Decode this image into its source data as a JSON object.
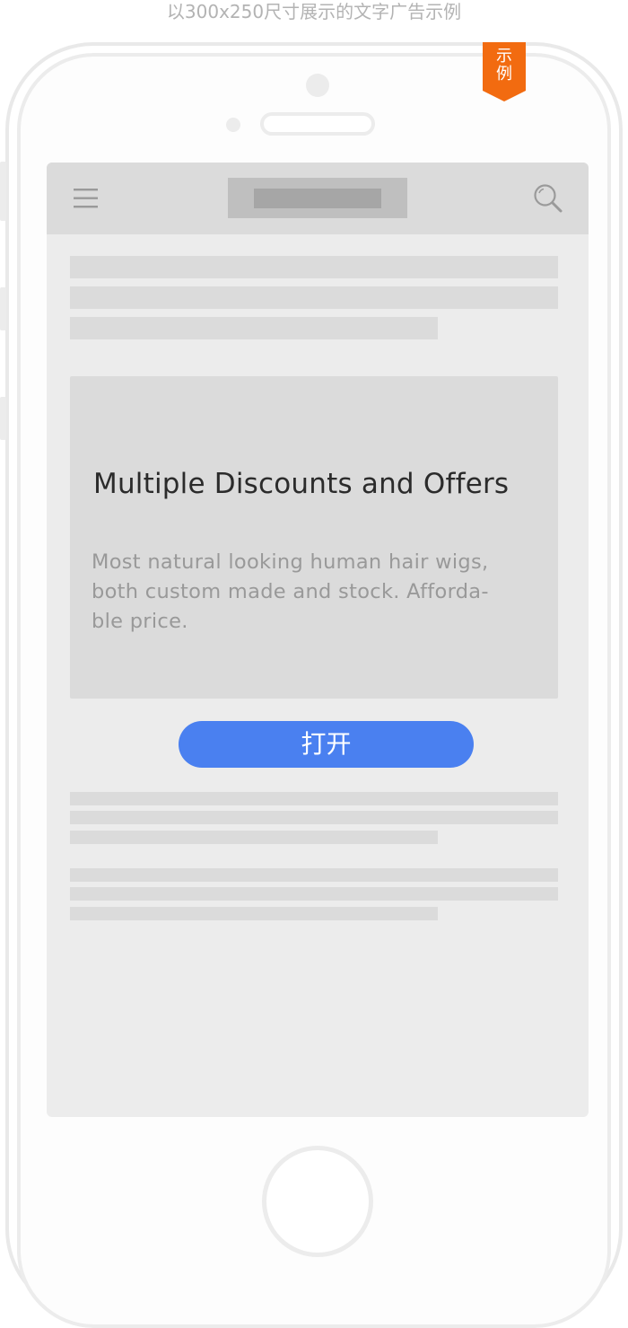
{
  "caption": "以300x250尺寸展示的文字广告示例",
  "badge": {
    "line1": "示",
    "line2": "例"
  },
  "header": {
    "menu_icon": "hamburger-menu-icon",
    "logo": "logo-placeholder",
    "search_icon": "search-icon"
  },
  "ad": {
    "title": "Multiple Discounts and Offers",
    "description_lines": [
      "Most natural looking human hair wigs,",
      "both custom made and stock. Afforda-",
      "ble price."
    ]
  },
  "button": {
    "label": "打开"
  },
  "colors": {
    "accent": "#4a80f0",
    "badge": "#f26b10",
    "placeholder": "#dbdbdb",
    "screen_bg": "#ececec"
  }
}
